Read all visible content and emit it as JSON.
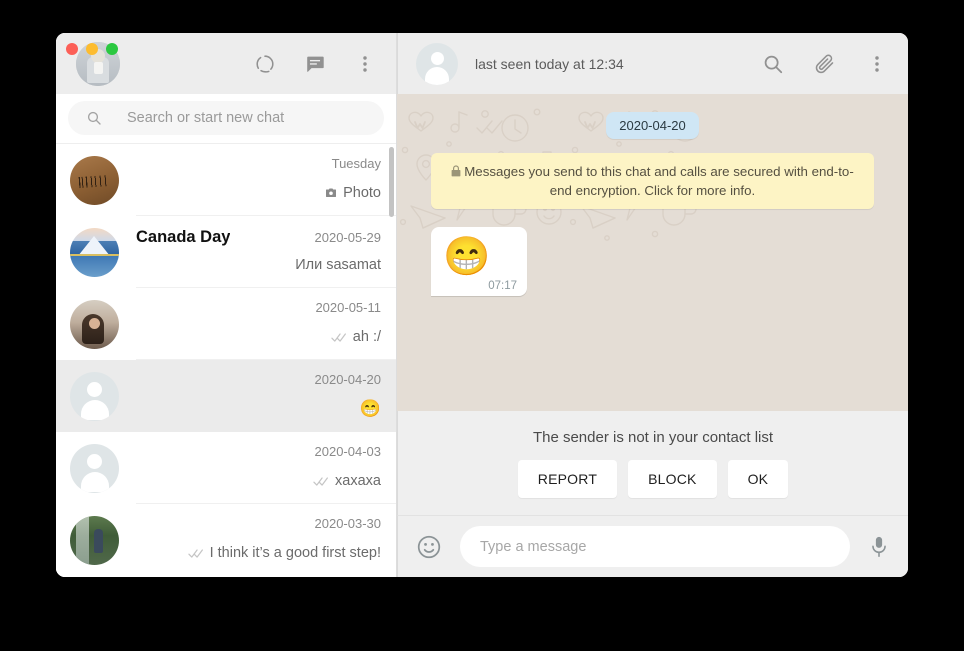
{
  "window": {
    "traffic_lights": [
      "close",
      "minimize",
      "maximize"
    ]
  },
  "sidebar": {
    "header": {
      "profile_avatar": "user-photo-avatar",
      "actions": [
        {
          "name": "status-icon",
          "label": "Status"
        },
        {
          "name": "new-chat-icon",
          "label": "New chat"
        },
        {
          "name": "menu-icon",
          "label": "Menu"
        }
      ]
    },
    "search": {
      "placeholder": "Search or start new chat",
      "value": "",
      "icon": "search-icon"
    },
    "chats": [
      {
        "name": "",
        "time": "Tuesday",
        "preview": "Photo",
        "preview_icon": "camera-icon",
        "ticks": false,
        "avatar": "wood-sign-photo",
        "selected": false
      },
      {
        "name": "Canada Day",
        "time": "2020-05-29",
        "preview": "Или sasamat",
        "preview_icon": "",
        "ticks": false,
        "avatar": "mountain-lake-photo",
        "selected": false
      },
      {
        "name": "",
        "time": "2020-05-11",
        "preview": "ah :/",
        "preview_icon": "",
        "ticks": true,
        "avatar": "cafe-person-photo",
        "selected": false
      },
      {
        "name": "",
        "time": "2020-04-20",
        "preview": "😁",
        "preview_icon": "",
        "ticks": false,
        "avatar": "default-person",
        "selected": true
      },
      {
        "name": "",
        "time": "2020-04-03",
        "preview": "xaxaxa",
        "preview_icon": "",
        "ticks": true,
        "avatar": "default-person",
        "selected": false
      },
      {
        "name": "",
        "time": "2020-03-30",
        "preview": "I think it’s a good first step!",
        "preview_icon": "",
        "ticks": true,
        "avatar": "waterfall-person-photo",
        "selected": false
      }
    ]
  },
  "chat": {
    "header": {
      "contact_name": "",
      "status": "last seen today at 12:34",
      "avatar": "default-person",
      "actions": [
        {
          "name": "search-icon",
          "label": "Search"
        },
        {
          "name": "attach-icon",
          "label": "Attach"
        },
        {
          "name": "menu-icon",
          "label": "Menu"
        }
      ]
    },
    "date_divider": "2020-04-20",
    "encryption_notice": "Messages you send to this chat and calls are secured with end-to-end encryption. Click for more info.",
    "messages": [
      {
        "type": "emoji",
        "text": "😁",
        "time": "07:17",
        "direction": "incoming"
      }
    ],
    "contact_prompt": {
      "text": "The sender is not in your contact list",
      "buttons": [
        "REPORT",
        "BLOCK",
        "OK"
      ]
    },
    "composer": {
      "placeholder": "Type a message",
      "value": "",
      "emoji_icon": "smiley-icon",
      "mic_icon": "microphone-icon"
    }
  },
  "colors": {
    "header_bg": "#ededed",
    "chat_bg": "#e4ddd5",
    "selected_row": "#ebebeb",
    "date_bubble": "#cfe6f5",
    "encryption_bubble": "#fdf4c5",
    "outgoing_tick": "#c5c5c5"
  }
}
